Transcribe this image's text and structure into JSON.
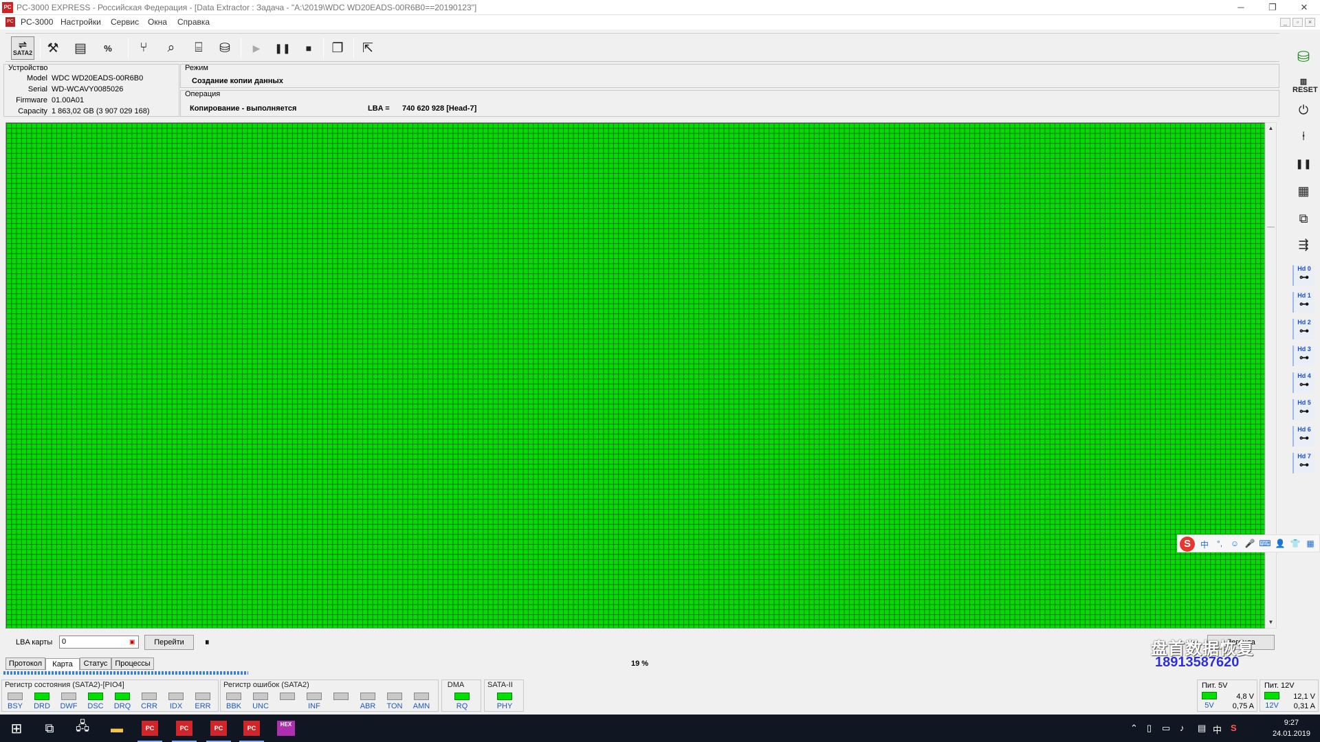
{
  "window": {
    "title": "PC-3000 EXPRESS - Российская Федерация - [Data Extractor : Задача - \"A:\\2019\\WDC WD20EADS-00R6B0==20190123\"]",
    "app_icon": "pc3000-icon",
    "minimize": "─",
    "restore": "❐",
    "close": "✕"
  },
  "menu": {
    "items": [
      "PC-3000",
      "Настройки",
      "Сервис",
      "Окна",
      "Справка"
    ],
    "mdi_minimize": "_",
    "mdi_restore": "▫",
    "mdi_close": "×"
  },
  "toolbar": {
    "sata_label": "SATA2",
    "icons": [
      "tools-icon",
      "passport-icon",
      "percent-icon",
      "tree-icon",
      "search-icon",
      "chip-icon",
      "disk-icon",
      "play-icon",
      "pause-icon",
      "stop-icon",
      "copy-icon",
      "exit-icon"
    ]
  },
  "device": {
    "group_title": "Устройство",
    "model_label": "Model",
    "model": "WDC WD20EADS-00R6B0",
    "serial_label": "Serial",
    "serial": "WD-WCAVY0085026",
    "firmware_label": "Firmware",
    "firmware": "01.00A01",
    "capacity_label": "Capacity",
    "capacity": "1 863,02 GB (3 907 029 168)"
  },
  "mode": {
    "group_title": "Режим",
    "value": "Создание копии данных"
  },
  "operation": {
    "group_title": "Операция",
    "status": "Копирование - выполняется",
    "lba_label": "LBA =",
    "lba_value": "740 620 928  [Head-7]"
  },
  "map_panel": {
    "lba_label": "LBA карты",
    "lba_input": "0",
    "goto_button": "Перейти",
    "pause_glyph": "⏸",
    "right_button": "Легенда"
  },
  "tabs": [
    "Протокол",
    "Карта",
    "Статус",
    "Процессы"
  ],
  "active_tab": "Карта",
  "progress": {
    "percent_text": "19 %",
    "value": 0.19
  },
  "status_register": {
    "title": "Регистр состояния (SATA2)-[PIO4]",
    "leds": [
      {
        "label": "BSY",
        "on": false
      },
      {
        "label": "DRD",
        "on": true
      },
      {
        "label": "DWF",
        "on": false
      },
      {
        "label": "DSC",
        "on": true
      },
      {
        "label": "DRQ",
        "on": true
      },
      {
        "label": "CRR",
        "on": false
      },
      {
        "label": "IDX",
        "on": false
      },
      {
        "label": "ERR",
        "on": false
      }
    ]
  },
  "error_register": {
    "title": "Регистр ошибок  (SATA2)",
    "leds": [
      {
        "label": "BBK",
        "on": false
      },
      {
        "label": "UNC",
        "on": false
      },
      {
        "label": "",
        "on": false
      },
      {
        "label": "INF",
        "on": false
      },
      {
        "label": "",
        "on": false
      },
      {
        "label": "ABR",
        "on": false
      },
      {
        "label": "TON",
        "on": false
      },
      {
        "label": "AMN",
        "on": false
      }
    ]
  },
  "dma": {
    "title": "DMA",
    "led_label": "RQ",
    "on": true
  },
  "sata": {
    "title": "SATA-II",
    "led_label": "PHY",
    "on": true
  },
  "power5": {
    "title": "Пит. 5V",
    "led_label": "5V",
    "voltage": "4,8 V",
    "current": "0,75 A"
  },
  "power12": {
    "title": "Пит. 12V",
    "led_label": "12V",
    "voltage": "12,1 V",
    "current": "0,31 A"
  },
  "right_tools": {
    "icons": [
      "power-drive-icon",
      "reset-icon",
      "sleep-icon",
      "probe-icon",
      "pause-icon",
      "ports-icon",
      "remove-icon",
      "cable-icon"
    ],
    "heads": [
      "Hd 0",
      "Hd 1",
      "Hd 2",
      "Hd 3",
      "Hd 4",
      "Hd 5",
      "Hd 6",
      "Hd 7"
    ]
  },
  "watermark": {
    "text": "盘首数据恢复",
    "phone": "18913587620"
  },
  "ime_bar": {
    "logo": "S",
    "items": [
      "中",
      "°,",
      "☺",
      "🎤",
      "⌨",
      "👤",
      "👕",
      "▦"
    ]
  },
  "taskbar": {
    "apps": [
      "pc3000",
      "pc3000",
      "pc3000",
      "pc3000"
    ],
    "hex_label": "HEX",
    "tray_lang": "中",
    "time": "9:27",
    "date": "24.01.2019"
  },
  "colors": {
    "map_ok": "#00dd00",
    "led_on": "#00e000",
    "led_label": "#1c57c4",
    "watermark_phone": "#2d2de0"
  }
}
